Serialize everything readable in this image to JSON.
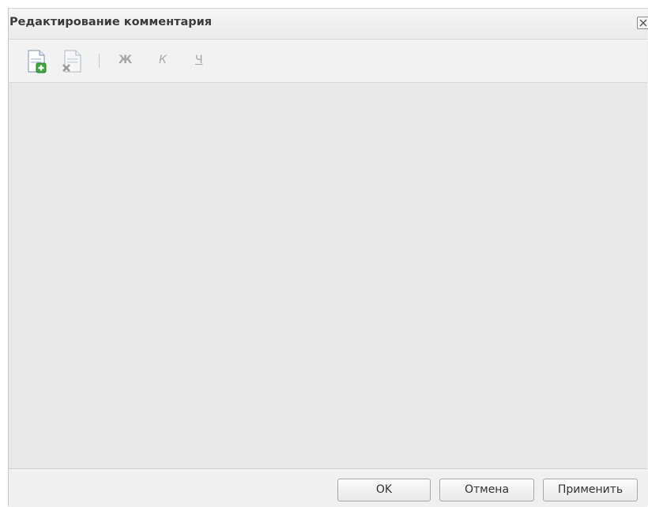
{
  "dialog": {
    "title": "Редактирование комментария",
    "close_icon": "close-x-icon"
  },
  "toolbar": {
    "add_icon": "document-add-icon",
    "delete_icon": "document-delete-icon",
    "bold_label": "Ж",
    "italic_label": "К",
    "underline_label": "Ч"
  },
  "editor": {
    "content": ""
  },
  "footer": {
    "ok_label": "OK",
    "cancel_label": "Отмена",
    "apply_label": "Применить"
  },
  "colors": {
    "dialog_bg": "#f0f0f0",
    "editor_bg": "#e8e8e8",
    "disabled_text": "#a8a8a8",
    "add_accent": "#3aa83a"
  }
}
